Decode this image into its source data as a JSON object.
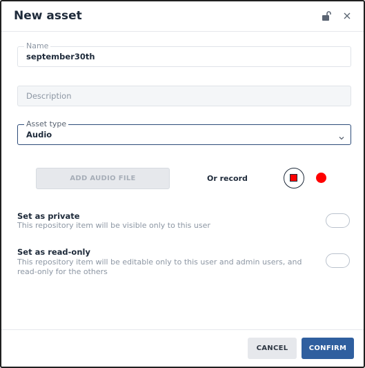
{
  "dialog": {
    "title": "New asset",
    "lock_icon": "lock-open-icon",
    "close_icon": "close-icon"
  },
  "fields": {
    "name": {
      "label": "Name",
      "value": "september30th"
    },
    "description": {
      "placeholder": "Description"
    },
    "asset_type": {
      "label": "Asset type",
      "value": "Audio",
      "icon": "chevron-down-icon"
    }
  },
  "audio": {
    "add_file_label": "ADD AUDIO FILE",
    "or_record_label": "Or record",
    "stop_icon": "stop-icon",
    "record_icon": "record-icon",
    "accent_color": "#ff0000"
  },
  "options": {
    "private": {
      "title": "Set as private",
      "description": "This repository item will be visible only to this user",
      "enabled": false
    },
    "read_only": {
      "title": "Set as read-only",
      "description": "This repository item will be editable only to this user and admin users, and read-only for the others",
      "enabled": false
    }
  },
  "footer": {
    "cancel_label": "CANCEL",
    "confirm_label": "CONFIRM",
    "confirm_color": "#2f5f9f"
  }
}
